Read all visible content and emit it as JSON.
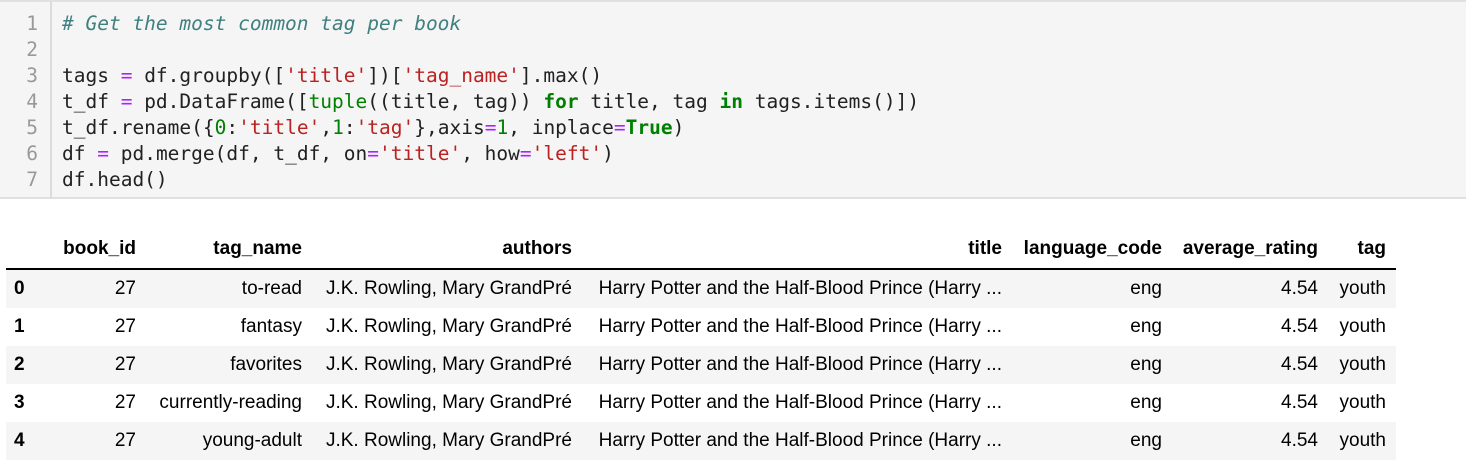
{
  "code_cell": {
    "line_numbers": [
      "1",
      "2",
      "3",
      "4",
      "5",
      "6",
      "7"
    ],
    "comment": "# Get the most common tag per book",
    "l3": {
      "a": "tags ",
      "eq": "=",
      "b": " df.groupby([",
      "s1": "'title'",
      "c": "])[",
      "s2": "'tag_name'",
      "d": "].max()"
    },
    "l4": {
      "a": "t_df ",
      "eq": "=",
      "b": " pd.DataFrame([",
      "f1": "tuple",
      "c": "((title, tag)) ",
      "k1": "for",
      "d": " title, tag ",
      "k2": "in",
      "e": " tags.items()])"
    },
    "l5": {
      "a": "t_df.rename({",
      "n0": "0",
      "c1": ":",
      "s1": "'title'",
      "c2": ",",
      "n1": "1",
      "c3": ":",
      "s2": "'tag'",
      "c4": "},axis",
      "eq1": "=",
      "n2": "1",
      "c5": ", inplace",
      "eq2": "=",
      "k1": "True",
      "c6": ")"
    },
    "l6": {
      "a": "df ",
      "eq": "=",
      "b": " pd.merge(df, t_df, on",
      "eq2": "=",
      "s1": "'title'",
      "c": ", how",
      "eq3": "=",
      "s2": "'left'",
      "d": ")"
    },
    "l7": "df.head()"
  },
  "dataframe": {
    "columns": [
      "",
      "book_id",
      "tag_name",
      "authors",
      "title",
      "language_code",
      "average_rating",
      "tag"
    ],
    "rows": [
      {
        "index": "0",
        "book_id": "27",
        "tag_name": "to-read",
        "authors": "J.K. Rowling, Mary GrandPré",
        "title": "Harry Potter and the Half-Blood Prince (Harry ...",
        "language_code": "eng",
        "average_rating": "4.54",
        "tag": "youth"
      },
      {
        "index": "1",
        "book_id": "27",
        "tag_name": "fantasy",
        "authors": "J.K. Rowling, Mary GrandPré",
        "title": "Harry Potter and the Half-Blood Prince (Harry ...",
        "language_code": "eng",
        "average_rating": "4.54",
        "tag": "youth"
      },
      {
        "index": "2",
        "book_id": "27",
        "tag_name": "favorites",
        "authors": "J.K. Rowling, Mary GrandPré",
        "title": "Harry Potter and the Half-Blood Prince (Harry ...",
        "language_code": "eng",
        "average_rating": "4.54",
        "tag": "youth"
      },
      {
        "index": "3",
        "book_id": "27",
        "tag_name": "currently-reading",
        "authors": "J.K. Rowling, Mary GrandPré",
        "title": "Harry Potter and the Half-Blood Prince (Harry ...",
        "language_code": "eng",
        "average_rating": "4.54",
        "tag": "youth"
      },
      {
        "index": "4",
        "book_id": "27",
        "tag_name": "young-adult",
        "authors": "J.K. Rowling, Mary GrandPré",
        "title": "Harry Potter and the Half-Blood Prince (Harry ...",
        "language_code": "eng",
        "average_rating": "4.54",
        "tag": "youth"
      }
    ]
  },
  "colors": {
    "comment": "#408080",
    "string": "#ba2121",
    "operator": "#aa22ff",
    "keyword": "#008000",
    "cell_background": "#f5f5f5"
  }
}
